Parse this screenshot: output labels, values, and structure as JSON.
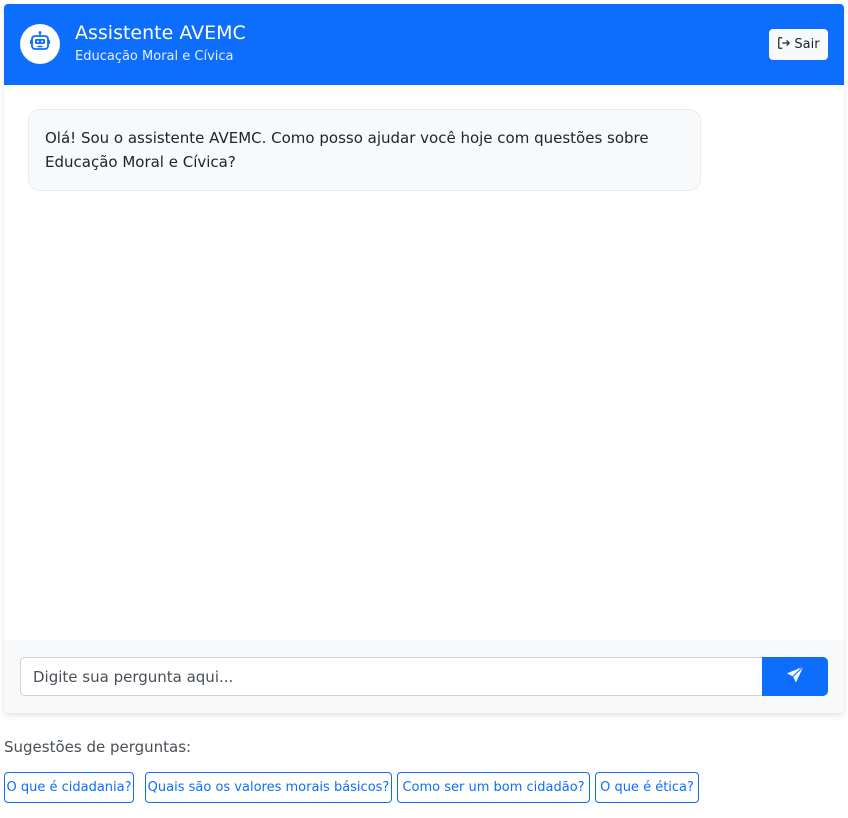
{
  "header": {
    "title": "Assistente AVEMC",
    "subtitle": "Educação Moral e Cívica",
    "avatar_icon": "robot-icon",
    "logout_icon": "sign-out-icon",
    "logout_label": "Sair"
  },
  "chat": {
    "messages": [
      {
        "sender": "bot",
        "text": "Olá! Sou o assistente AVEMC. Como posso ajudar você hoje com questões sobre Educação Moral e Cívica?"
      }
    ]
  },
  "composer": {
    "placeholder": "Digite sua pergunta aqui...",
    "send_icon": "paper-plane-icon"
  },
  "suggestions": {
    "label": "Sugestões de perguntas:",
    "items": [
      "O que é cidadania?",
      "Quais são os valores morais básicos?",
      "Como ser um bom cidadão?",
      "O que é ética?"
    ]
  },
  "colors": {
    "primary": "#0d6efd",
    "bubble_bg": "#f8f9fa",
    "input_bar_bg": "#f8f9fa"
  }
}
